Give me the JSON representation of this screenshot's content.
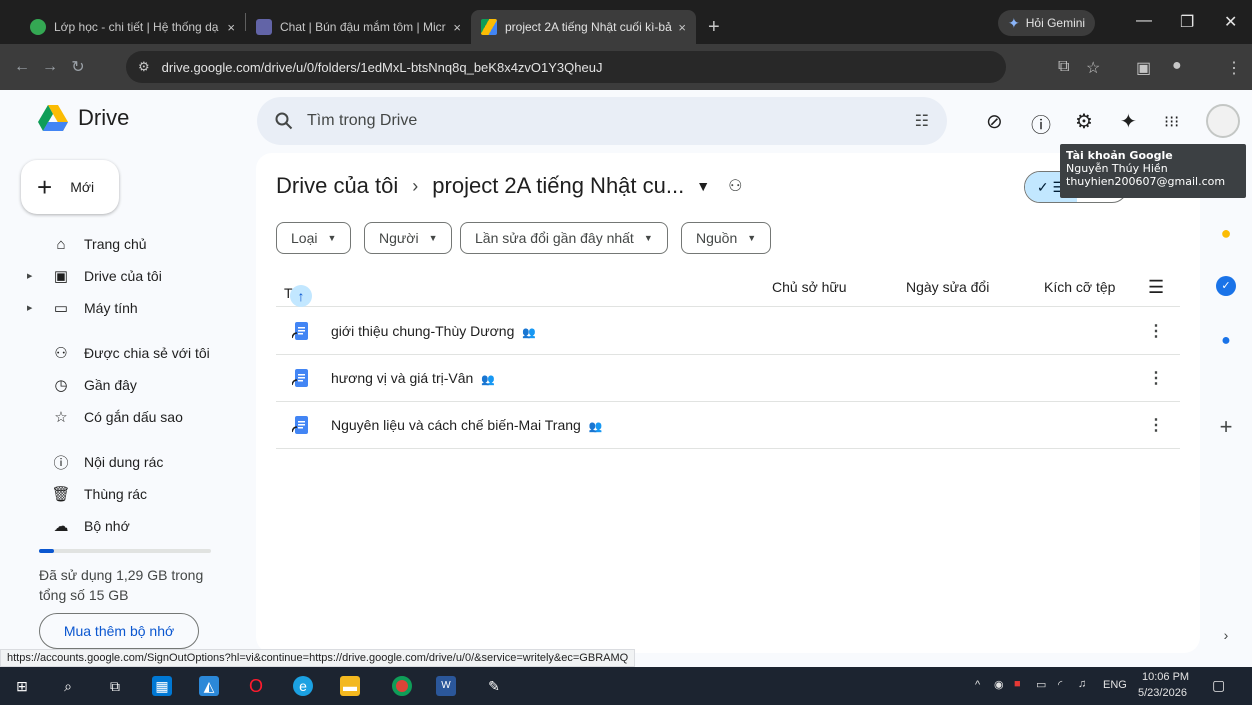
{
  "browser": {
    "tabs": [
      {
        "title": "Lớp học - chi tiết | Hệ thống dạ",
        "close": "×",
        "color": "#34a853"
      },
      {
        "title": "Chat | Bún đậu mắm tôm | Micr",
        "close": "×",
        "color": "#6264a7"
      },
      {
        "title": "project 2A tiếng Nhật cuối kì-bả",
        "close": "×",
        "color": "#fbbc04"
      }
    ],
    "new_tab": "+",
    "gemini_label": "Hỏi Gemini",
    "url": "drive.google.com/drive/u/0/folders/1edMxL-btsNnq8q_beK8x4zvO1Y3QheuJ"
  },
  "drive": {
    "app_name": "Drive",
    "search_placeholder": "Tìm trong Drive"
  },
  "tooltip": {
    "title": "Tài khoản Google",
    "name": "Nguyễn Thúy Hiền",
    "email": "thuyhien200607@gmail.com"
  },
  "sidebar": {
    "new_label": "Mới",
    "items": [
      {
        "label": "Trang chủ",
        "icon": "home-icon"
      },
      {
        "label": "Drive của tôi",
        "icon": "my-drive-icon"
      },
      {
        "label": "Máy tính",
        "icon": "computer-icon"
      },
      {
        "label": "Được chia sẻ với tôi",
        "icon": "shared-icon"
      },
      {
        "label": "Gần đây",
        "icon": "clock-icon"
      },
      {
        "label": "Có gắn dấu sao",
        "icon": "star-icon"
      },
      {
        "label": "Nội dung rác",
        "icon": "spam-icon"
      },
      {
        "label": "Thùng rác",
        "icon": "trash-icon"
      },
      {
        "label": "Bộ nhớ",
        "icon": "cloud-icon"
      }
    ],
    "storage_used_fraction": 0.086,
    "storage_text_line1": "Đã sử dụng 1,29 GB trong",
    "storage_text_line2": "tổng số 15 GB",
    "buy_storage": "Mua thêm bộ nhớ"
  },
  "main": {
    "breadcrumb_root": "Drive của tôi",
    "breadcrumb_sep": "›",
    "folder_name": "project 2A tiếng Nhật cu...",
    "filters": [
      "Loại",
      "Người",
      "Lần sửa đổi gần đây nhất",
      "Nguồn"
    ],
    "columns": {
      "name": "Tên",
      "owner": "Chủ sở hữu",
      "modified": "Ngày sửa đổi",
      "size": "Kích cỡ tệp"
    },
    "files": [
      {
        "name": "giới thiệu chung-Thùy Dương"
      },
      {
        "name": "hương vị và giá trị-Vân"
      },
      {
        "name": "Nguyên liệu và cách chế biến-Mai Trang"
      }
    ]
  },
  "status_url": "https://accounts.google.com/SignOutOptions?hl=vi&continue=https://drive.google.com/drive/u/0/&service=writely&ec=GBRAMQ",
  "taskbar": {
    "lang": "ENG",
    "time": "10:06 PM",
    "date": "5/23/2026"
  }
}
